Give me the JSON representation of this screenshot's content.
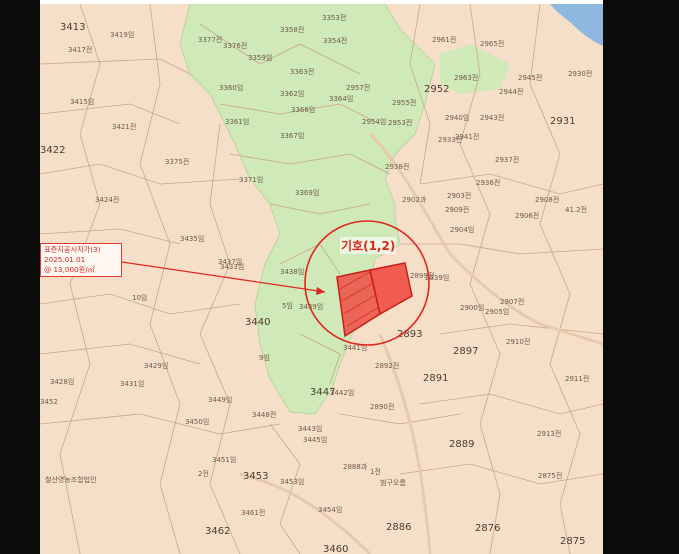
{
  "map": {
    "callout": {
      "line1": "표준지공시지가(3)",
      "line2": "2025.01.01",
      "line3": "@ 13,000원/㎡"
    },
    "marker_label": "기호(1,2)",
    "colors": {
      "parcel_bg": "#f6dfc9",
      "green_zone": "#cfe9b8",
      "boundary": "#c9a58a",
      "highlight": "#e0271e",
      "water": "#8fb8e0"
    },
    "lot_labels": [
      "3413",
      "3417전",
      "3419임",
      "3415임",
      "3421전",
      "3422",
      "3375전",
      "3424전",
      "3377전",
      "3376전",
      "3358전",
      "3353전",
      "3354전",
      "3359임",
      "3360임",
      "3362임",
      "3363전",
      "3364임",
      "3366임",
      "3361임",
      "3367임",
      "3371임",
      "3369임",
      "3435임",
      "3437임",
      "3439임",
      "3440",
      "3441임",
      "3443임",
      "3445임",
      "3447",
      "3442임",
      "3428임",
      "3429임",
      "3431임",
      "3449임",
      "3450임",
      "3448전",
      "3451임",
      "3453",
      "3452",
      "3453임",
      "3461전",
      "3462",
      "3460",
      "3454임",
      "2957전",
      "2952",
      "2955전",
      "2953전",
      "2954임",
      "2940임",
      "2941전",
      "2943전",
      "2961전",
      "2965전",
      "2963전",
      "2945전",
      "2944전",
      "2930전",
      "2931",
      "2938전",
      "2902과",
      "2903전",
      "2904임",
      "2906전",
      "2936전",
      "2899전",
      "2907전",
      "2905임",
      "2893",
      "2897",
      "2891",
      "2890전",
      "2892전",
      "2889",
      "2888과",
      "2910전",
      "2911전",
      "2913전",
      "2875전",
      "2876",
      "2875",
      "2886",
      "2908전",
      "2909전",
      "2900임",
      "2939임",
      "2933전",
      "2937전",
      "철산영농조합법인",
      "범구오름",
      "41.2전",
      "3433임",
      "3438임",
      "5임",
      "9임",
      "10임",
      "2전",
      "1전"
    ]
  }
}
